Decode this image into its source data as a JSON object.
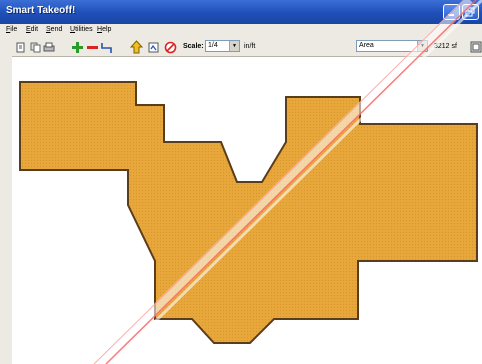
{
  "window": {
    "title": "Smart Takeoff!"
  },
  "menu": [
    "File",
    "Edit",
    "Send",
    "Utilities",
    "Help"
  ],
  "toolbar": {
    "scale_label": "Scale:",
    "scale_value": "1/4",
    "scale_unit": "in/ft",
    "measure_type": "Area",
    "measure_value": "3212 sf"
  },
  "icons": [
    "open-icon",
    "copy-icon",
    "print-icon",
    "add-icon",
    "remove-icon",
    "segment-icon",
    "up-arrow-icon",
    "edit-icon",
    "stop-icon",
    "options-icon"
  ],
  "colors": {
    "shape_fill": "#e8a73a",
    "shape_stroke": "#5a3d1c",
    "titlebar": "#2456c5",
    "canvas": "#ffffff"
  }
}
